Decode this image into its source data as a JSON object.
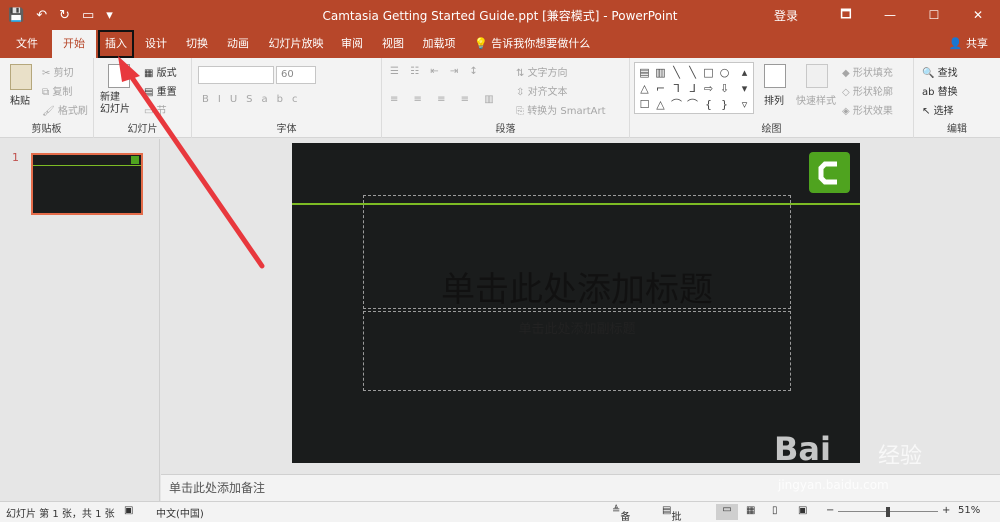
{
  "titlebar": {
    "title": "Camtasia Getting Started Guide.ppt [兼容模式] - PowerPoint",
    "login": "登录",
    "qat": [
      "💾",
      "↶",
      "↻",
      "▭",
      "▾"
    ],
    "window_buttons": [
      "🗖",
      "—",
      "☐",
      "✕"
    ]
  },
  "tabs": [
    "文件",
    "开始",
    "插入",
    "设计",
    "切换",
    "动画",
    "幻灯片放映",
    "审阅",
    "视图",
    "加载项"
  ],
  "tell_me": "告诉我你想要做什么",
  "share": "共享",
  "ribbon": {
    "clipboard": {
      "paste": "粘贴",
      "cut": "剪切",
      "copy": "复制",
      "format_painter": "格式刷",
      "label": "剪贴板"
    },
    "slides": {
      "new_slide": "新建\n幻灯片",
      "layout": "版式",
      "reset": "重置",
      "section": "节",
      "label": "幻灯片"
    },
    "font": {
      "size": "60",
      "label": "字体",
      "buttons": [
        "B",
        "I",
        "U",
        "S",
        "abc",
        "AV",
        "Aa",
        "A"
      ]
    },
    "paragraph": {
      "text_direction": "文字方向",
      "align_text": "对齐文本",
      "smartart": "转换为 SmartArt",
      "label": "段落"
    },
    "drawing": {
      "arrange": "排列",
      "quick_styles": "快速样式",
      "fill": "形状填充",
      "outline": "形状轮廓",
      "effects": "形状效果",
      "label": "绘图"
    },
    "editing": {
      "find": "查找",
      "replace": "替换",
      "select": "选择",
      "label": "编辑"
    }
  },
  "thumbnails": {
    "number": "1"
  },
  "slide": {
    "title_placeholder": "单击此处添加标题",
    "subtitle_placeholder": "单击此处添加副标题"
  },
  "notes_placeholder": "单击此处添加备注",
  "status": {
    "slide_info": "幻灯片 第 1 张，共 1 张",
    "language": "中文(中国)",
    "notes": "备注",
    "comments": "批注",
    "zoom": "51%"
  },
  "watermark": {
    "brand": "Bai",
    "cn": "经验",
    "url": "jingyan.baidu.com"
  },
  "colors": {
    "accent": "#b7472a",
    "slide_bg": "#1a1c1c",
    "green": "#7dbb24",
    "arrow": "#e8383d"
  }
}
